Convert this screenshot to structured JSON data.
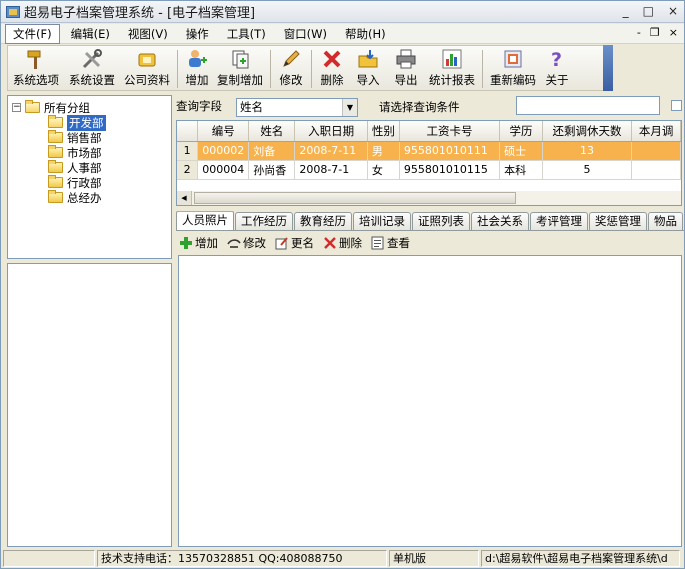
{
  "window": {
    "title": "超易电子档案管理系统 - [电子档案管理]",
    "minimize": "_",
    "maximize": "□",
    "close": "×"
  },
  "menu": {
    "items": [
      "文件(F)",
      "编辑(E)",
      "视图(V)",
      "操作",
      "工具(T)",
      "窗口(W)",
      "帮助(H)"
    ],
    "mdi_min": "-",
    "mdi_restore": "❐",
    "mdi_close": "×"
  },
  "toolbar": {
    "buttons": [
      {
        "label": "系统选项",
        "icon": "hammer-icon"
      },
      {
        "label": "系统设置",
        "icon": "tools-icon"
      },
      {
        "label": "公司资料",
        "icon": "company-icon"
      },
      {
        "label": "增加",
        "icon": "add-user-icon"
      },
      {
        "label": "复制增加",
        "icon": "copy-add-icon"
      },
      {
        "label": "修改",
        "icon": "pencil-icon"
      },
      {
        "label": "删除",
        "icon": "delete-x-icon"
      },
      {
        "label": "导入",
        "icon": "import-icon"
      },
      {
        "label": "导出",
        "icon": "printer-export-icon"
      },
      {
        "label": "统计报表",
        "icon": "chart-icon"
      },
      {
        "label": "重新编码",
        "icon": "recode-icon"
      },
      {
        "label": "关于",
        "icon": "help-question-icon"
      }
    ]
  },
  "tree": {
    "root": "所有分组",
    "children": [
      "开发部",
      "销售部",
      "市场部",
      "人事部",
      "行政部",
      "总经办"
    ],
    "selected": "开发部"
  },
  "query": {
    "field_label": "查询字段",
    "field_value": "姓名",
    "condition_label": "请选择查询条件",
    "condition_value": ""
  },
  "grid": {
    "columns": [
      "编号",
      "姓名",
      "入职日期",
      "性别",
      "工资卡号",
      "学历",
      "还剩调休天数",
      "本月调"
    ],
    "rows": [
      {
        "rownum": "1",
        "cells": [
          "000002",
          "刘备",
          "2008-7-11",
          "男",
          "955801010111",
          "硕士",
          "13",
          ""
        ]
      },
      {
        "rownum": "2",
        "cells": [
          "000004",
          "孙尚香",
          "2008-7-1",
          "女",
          "955801010115",
          "本科",
          "5",
          ""
        ]
      }
    ]
  },
  "tabs": [
    "人员照片",
    "工作经历",
    "教育经历",
    "培训记录",
    "证照列表",
    "社会关系",
    "考评管理",
    "奖惩管理",
    "物品"
  ],
  "subtoolbar": {
    "buttons": [
      {
        "label": "增加",
        "icon": "add-plus-icon"
      },
      {
        "label": "修改",
        "icon": "edit-icon"
      },
      {
        "label": "更名",
        "icon": "rename-icon"
      },
      {
        "label": "删除",
        "icon": "delete-icon"
      },
      {
        "label": "查看",
        "icon": "view-icon"
      }
    ]
  },
  "status": {
    "support": "技术支持电话：13570328851 QQ:408088750",
    "edition": "单机版",
    "path": "d:\\超易软件\\超易电子档案管理系统\\d"
  }
}
